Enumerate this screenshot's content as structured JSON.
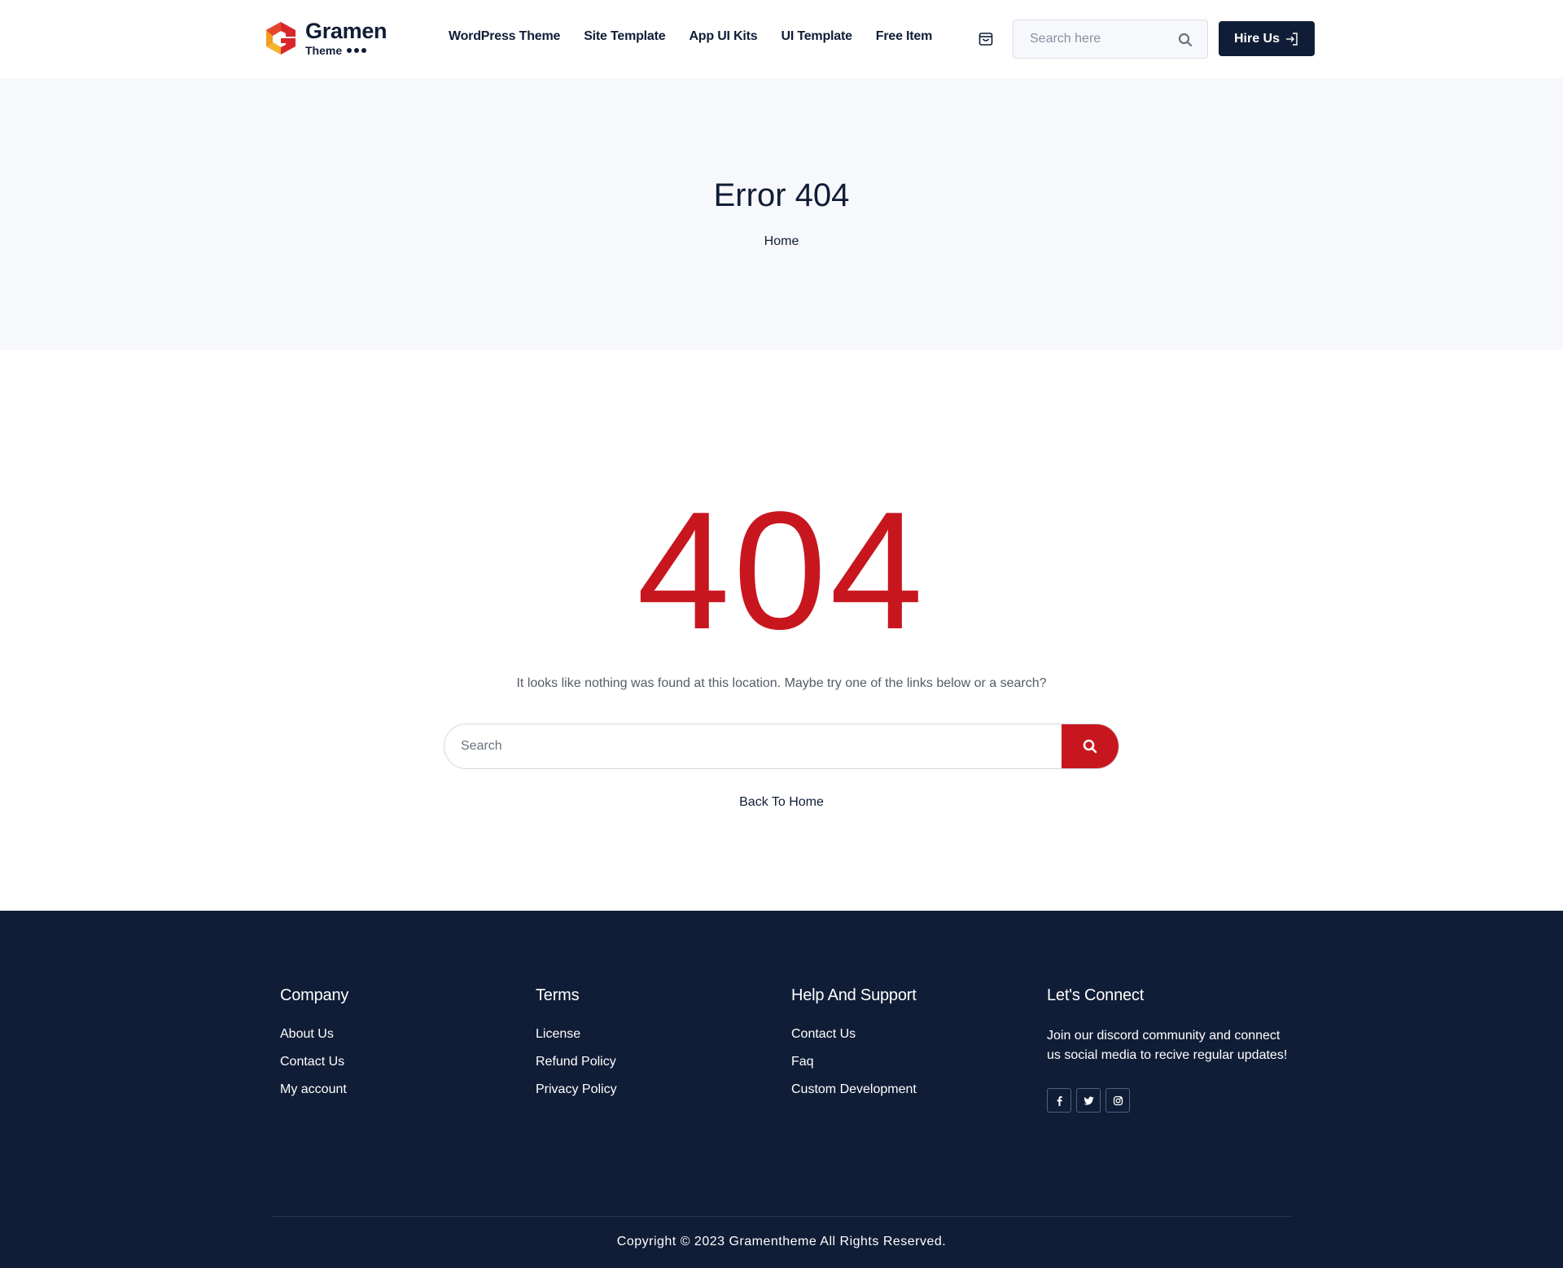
{
  "brand": {
    "name": "Gramen",
    "subtitle": "Theme",
    "colors": {
      "logo_red": "#d9262c",
      "logo_orange": "#f5a623",
      "navy": "#101d36",
      "accent_red": "#c8161f"
    }
  },
  "nav": {
    "items": [
      {
        "label": "WordPress Theme"
      },
      {
        "label": "Site Template"
      },
      {
        "label": "App UI Kits"
      },
      {
        "label": "UI Template"
      },
      {
        "label": "Free Item"
      }
    ]
  },
  "header": {
    "cart_icon": "shopping-bag-icon",
    "search_placeholder": "Search here",
    "search_icon": "search-icon",
    "hire_label": "Hire Us",
    "hire_icon": "login-arrow-icon"
  },
  "hero": {
    "title": "Error 404",
    "breadcrumb": "Home"
  },
  "main": {
    "code": "404",
    "message": "It looks like nothing was found at this location. Maybe try one of the links below or a search?",
    "search_placeholder": "Search",
    "back_home": "Back To Home"
  },
  "footer": {
    "columns": [
      {
        "title": "Company",
        "links": [
          "About Us",
          "Contact Us",
          "My account"
        ]
      },
      {
        "title": "Terms",
        "links": [
          "License",
          "Refund Policy",
          "Privacy Policy"
        ]
      },
      {
        "title": "Help And Support",
        "links": [
          "Contact Us",
          "Faq",
          "Custom Development"
        ]
      }
    ],
    "connect": {
      "title": "Let's Connect",
      "text": "Join our discord community and connect us social media to recive regular updates!",
      "social_icons": [
        "facebook-icon",
        "twitter-icon",
        "instagram-icon"
      ]
    },
    "copyright": "Copyright © 2023 Gramentheme All Rights Reserved."
  }
}
